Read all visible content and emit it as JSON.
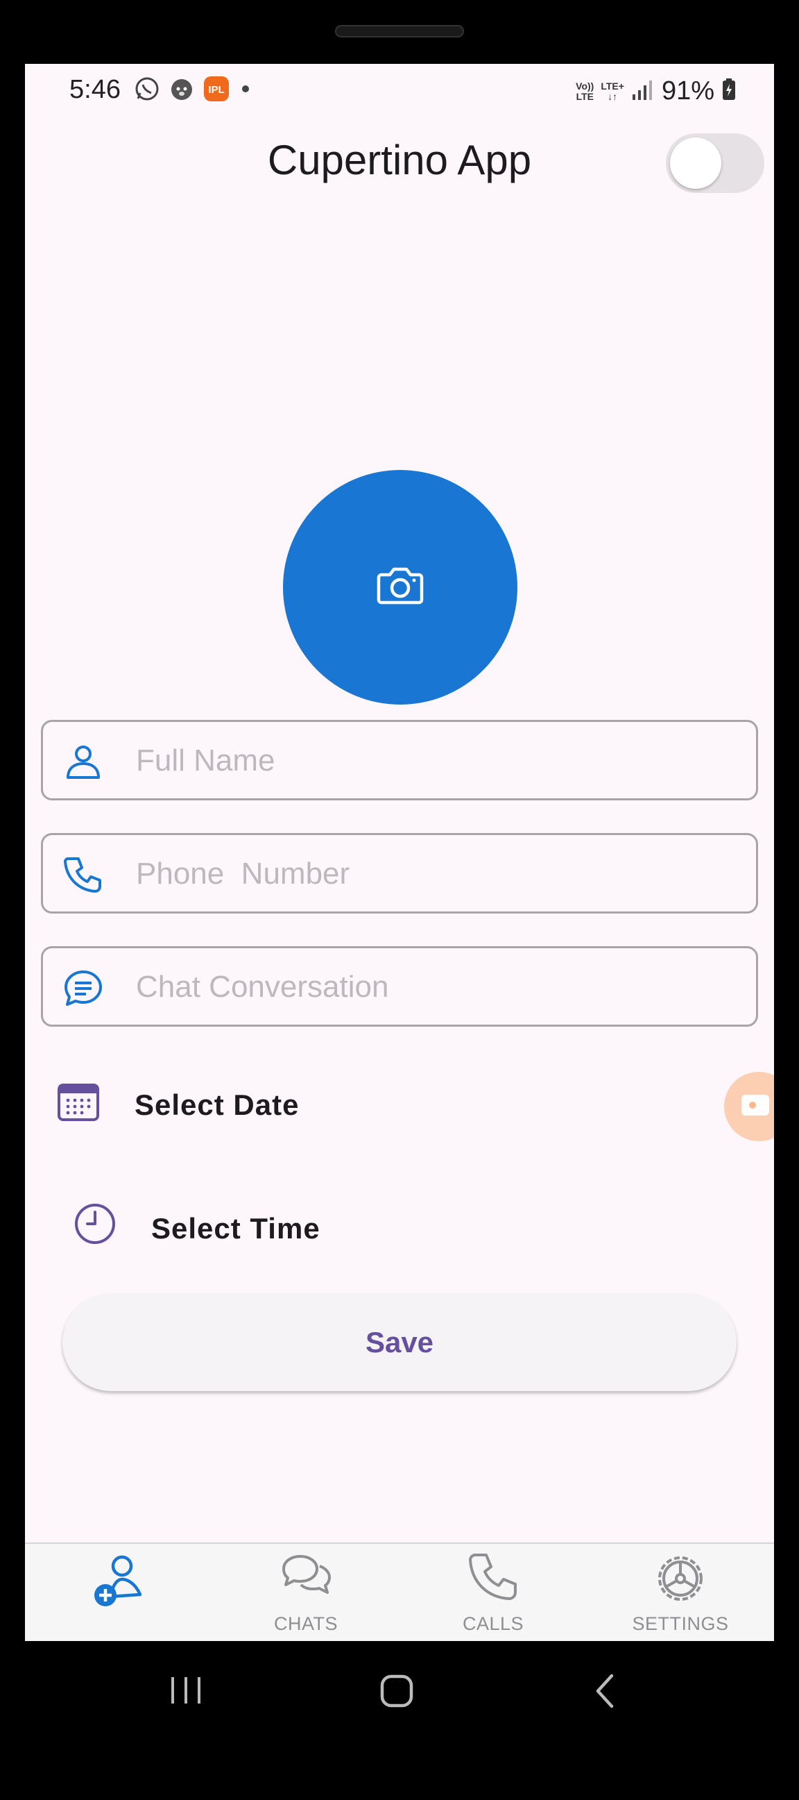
{
  "status_bar": {
    "time": "5:46",
    "network_top": "Vo))",
    "network_mid": "LTE",
    "network_right": "LTE+",
    "battery": "91%"
  },
  "app_bar": {
    "title": "Cupertino App"
  },
  "form": {
    "full_name_placeholder": "Full Name",
    "phone_placeholder": "Phone  Number",
    "chat_placeholder": "Chat Conversation",
    "select_date_label": "Select Date",
    "select_time_label": "Select Time",
    "save_label": "Save"
  },
  "tabs": [
    {
      "label": "",
      "icon": "add-contact-icon",
      "active": true
    },
    {
      "label": "CHATS",
      "icon": "chats-icon"
    },
    {
      "label": "CALLS",
      "icon": "calls-icon"
    },
    {
      "label": "SETTINGS",
      "icon": "settings-icon"
    }
  ],
  "colors": {
    "accent_blue": "#1976d2",
    "purple": "#65509e",
    "background": "#fdf7fc"
  }
}
